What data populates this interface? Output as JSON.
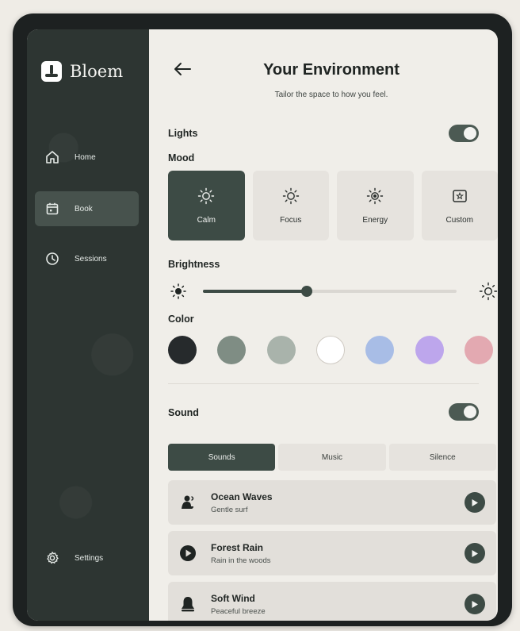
{
  "app": {
    "name": "Bloem"
  },
  "sidebar": {
    "items": [
      {
        "label": "Home",
        "icon": "home-icon"
      },
      {
        "label": "Book",
        "icon": "calendar-icon",
        "active": true
      },
      {
        "label": "Sessions",
        "icon": "clock-icon"
      },
      {
        "label": "Settings",
        "icon": "gear-icon"
      }
    ]
  },
  "header": {
    "title": "Your Environment",
    "subtitle": "Tailor the space to how you feel."
  },
  "lights": {
    "label": "Lights",
    "enabled": true,
    "mood_label": "Mood",
    "moods": [
      {
        "label": "Calm",
        "icon": "sun-icon",
        "active": true
      },
      {
        "label": "Focus",
        "icon": "sun-icon"
      },
      {
        "label": "Energy",
        "icon": "sun-bold-icon"
      },
      {
        "label": "Custom",
        "icon": "star-box-icon"
      }
    ],
    "brightness_label": "Brightness",
    "brightness_fraction": 0.41,
    "color_label": "Color",
    "colors": [
      "#262a2c",
      "#7f8d84",
      "#a9b3ab",
      "#ffffff",
      "#a8bde6",
      "#bda6ec",
      "#e3a9b1"
    ],
    "selected_color_index": 0
  },
  "sound": {
    "label": "Sound",
    "enabled": true,
    "tabs": [
      {
        "label": "Sounds",
        "active": true
      },
      {
        "label": "Music"
      },
      {
        "label": "Silence"
      }
    ],
    "items": [
      {
        "title": "Ocean Waves",
        "subtitle": "Gentle surf",
        "icon": "wave-person-icon"
      },
      {
        "title": "Forest Rain",
        "subtitle": "Rain in the woods",
        "icon": "play-circle-icon"
      },
      {
        "title": "Soft Wind",
        "subtitle": "Peaceful breeze",
        "icon": "bell-icon"
      }
    ]
  },
  "colors": {
    "accent": "#3d4b45",
    "sidebar": "#2d3532",
    "background": "#f0eee9"
  }
}
